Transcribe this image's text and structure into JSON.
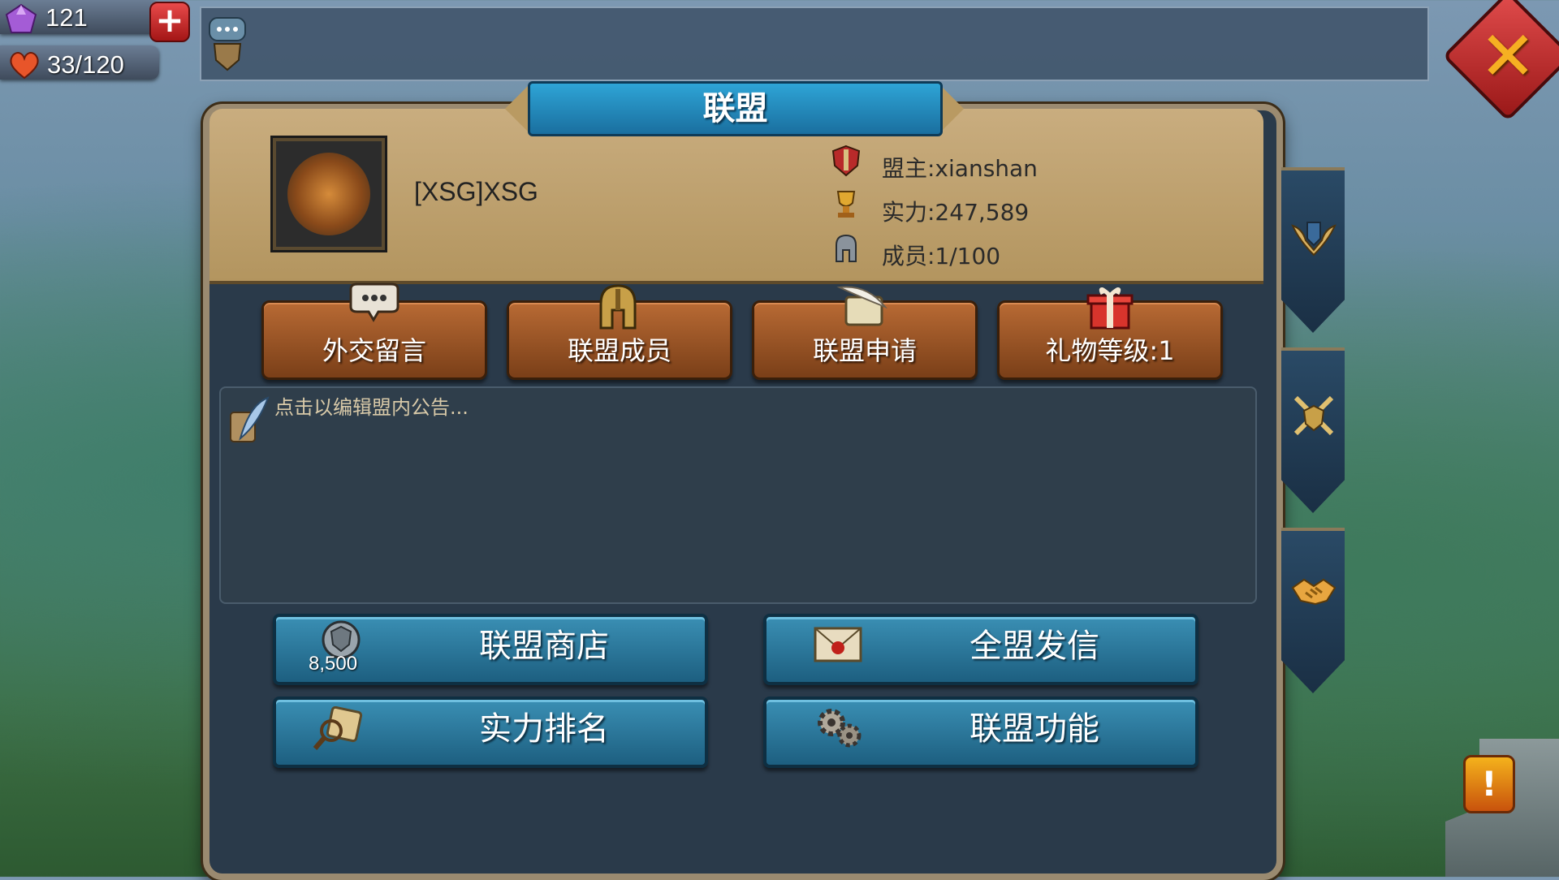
{
  "resources": {
    "gems": "121",
    "stamina": "33/120"
  },
  "panel": {
    "title": "联盟"
  },
  "guild": {
    "name": "[XSG]XSG",
    "leader": "盟主:xianshan",
    "power": "实力:247,589",
    "members": "成员:1/100"
  },
  "actions": [
    {
      "label": "外交留言",
      "icon": "speech-bubble-icon"
    },
    {
      "label": "联盟成员",
      "icon": "helmet-icon"
    },
    {
      "label": "联盟申请",
      "icon": "quill-scroll-icon"
    },
    {
      "label": "礼物等级:1",
      "icon": "gift-box-icon"
    }
  ],
  "announcement": {
    "placeholder": "点击以编辑盟内公告..."
  },
  "bottom_buttons": [
    {
      "label": "联盟商店",
      "icon": "guild-coin-icon",
      "cost": "8,500"
    },
    {
      "label": "全盟发信",
      "icon": "sealed-letter-icon"
    },
    {
      "label": "实力排名",
      "icon": "magnifier-scroll-icon"
    },
    {
      "label": "联盟功能",
      "icon": "gears-icon"
    }
  ],
  "side_tabs": [
    {
      "icon": "winged-shield-icon"
    },
    {
      "icon": "crossed-swords-icon"
    },
    {
      "icon": "handshake-icon"
    }
  ],
  "colors": {
    "panel_tan": "#c9ad7f",
    "button_brown": "#b86a34",
    "button_blue": "#3a8fb4",
    "close_red": "#e04b4b",
    "close_x_gold": "#f6b022"
  }
}
